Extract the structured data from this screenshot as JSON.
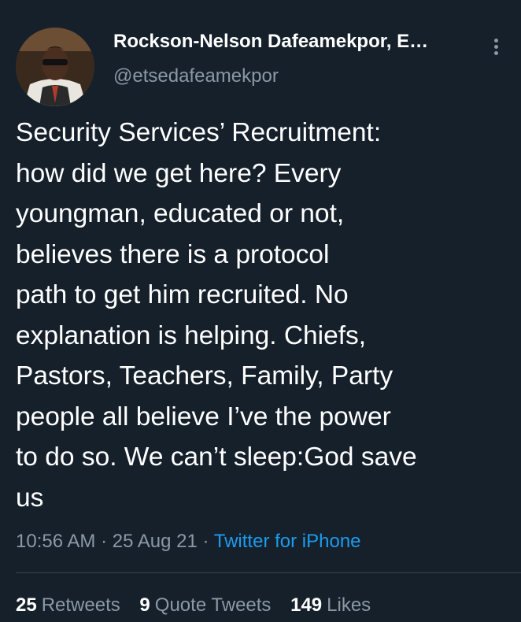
{
  "author": {
    "display_name": "Rockson-Nelson Dafeamekpor, E…",
    "handle": "@etsedafeamekpor",
    "avatar_icon": "profile-photo"
  },
  "tweet": {
    "text": "Security Services’ Recruitment:\nhow did we get here? Every\nyoungman, educated or not,\nbelieves there is a protocol\npath to get him recruited. No\nexplanation is helping. Chiefs,\nPastors, Teachers, Family, Party\npeople all believe I’ve the power\nto do so. We can’t sleep:God save\nus",
    "time": "10:56 AM",
    "date": "25 Aug 21",
    "source": "Twitter for iPhone",
    "separator": "·"
  },
  "stats": {
    "retweets": {
      "count": "25",
      "label": "Retweets"
    },
    "quotes": {
      "count": "9",
      "label": "Quote Tweets"
    },
    "likes": {
      "count": "149",
      "label": "Likes"
    }
  },
  "colors": {
    "background": "#15202b",
    "text": "#ffffff",
    "muted": "#8b98a5",
    "link": "#1d9bf0",
    "divider": "#38444d"
  },
  "icons": {
    "more": "more-vertical-icon"
  }
}
